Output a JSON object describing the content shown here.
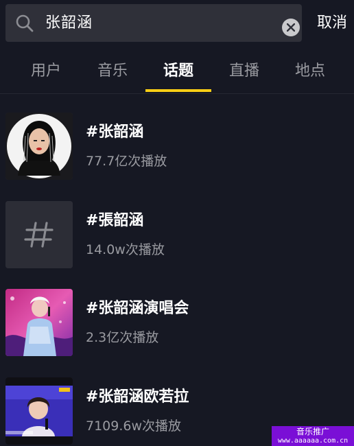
{
  "search": {
    "query": "张韶涵",
    "cancel_label": "取消"
  },
  "tabs": [
    {
      "label": "用户",
      "active": false
    },
    {
      "label": "音乐",
      "active": false
    },
    {
      "label": "话题",
      "active": true
    },
    {
      "label": "直播",
      "active": false
    },
    {
      "label": "地点",
      "active": false
    }
  ],
  "results": [
    {
      "title": "#张韶涵",
      "plays": "77.7亿次播放",
      "thumb": "portrait-photo"
    },
    {
      "title": "#張韶涵",
      "plays": "14.0w次播放",
      "thumb": "hashtag-icon"
    },
    {
      "title": "#张韶涵演唱会",
      "plays": "2.3亿次播放",
      "thumb": "concert-photo"
    },
    {
      "title": "#张韶涵欧若拉",
      "plays": "7109.6w次播放",
      "thumb": "stage-photo"
    }
  ],
  "watermark": {
    "line1": "音乐推广",
    "line2": "www.aaaaaa.com.cn"
  },
  "colors": {
    "background": "#161823",
    "search_bg": "#2f3039",
    "active_indicator": "#face15",
    "muted_text": "#9a9ba1"
  }
}
